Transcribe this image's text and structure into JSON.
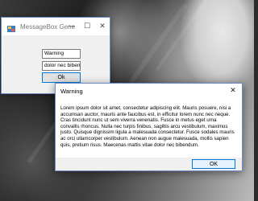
{
  "app_window": {
    "title": "MessageBox Genera...",
    "title_field_value": "Warning",
    "message_field_value": "dolor nec bibendum.",
    "ok_label": "Ok"
  },
  "message_box": {
    "title": "Warning",
    "close_glyph": "✕",
    "text": "Lorem ipsum dolor sit amet, consectetur adipiscing elit. Mauris posuere, nisi a accumsan auctor, mauris ante faucibus est, in efficitur lorem nunc nec neque. Cras tincidunt nunc ut sem viverra venenatis. Fusce in metus eget urna convallis rhoncus. Nulla nec turpis finibus, sagittis arcu vestibulum, maximus justo. Quisque dignissim ligula a malesuada consectetur. Fusce sodales mauris ac orci ullamcorper vestibulum. Aenean non augue malesuada, mollis sapien quis, pretium risus. Maecenas mattis vitae dolor nec bibendum.",
    "ok_label": "OK"
  },
  "title_bar_buttons": {
    "minimize": "—",
    "maximize": "☐",
    "close": "✕"
  },
  "colors": {
    "window_border": "#6b8cc7",
    "button_focus_border": "#0078d7"
  }
}
